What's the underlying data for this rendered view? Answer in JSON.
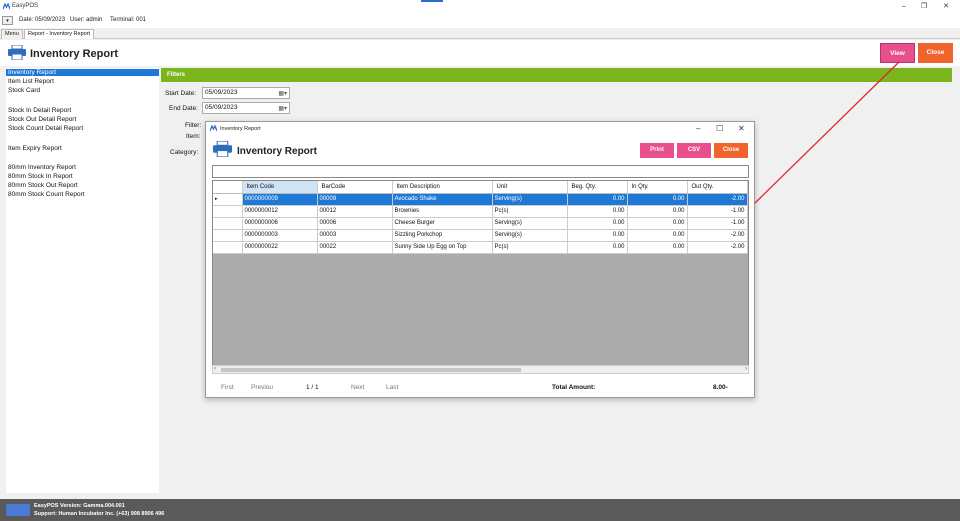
{
  "app": {
    "title": "EasyPOS"
  },
  "info": {
    "date": "Date: 05/09/2023",
    "user": "User: admin",
    "terminal": "Terminal: 001"
  },
  "tabs": [
    "Menu",
    "Report - Inventory Report"
  ],
  "header": {
    "title": "Inventory Report",
    "view_label": "View",
    "close_label": "Close"
  },
  "sidebar": {
    "items": [
      "Inventory Report",
      "Item List Report",
      "Stock Card",
      "Stock In Detail Report",
      "Stock Out Detail Report",
      "Stock Count Detail Report",
      "Item Expiry Report",
      "80mm Inventory Report",
      "80mm Stock In Report",
      "80mm Stock Out Report",
      "80mm Stock Count Report"
    ]
  },
  "filters": {
    "title": "Filters",
    "start_label": "Start Date:",
    "start_value": "05/09/2023",
    "end_label": "End Date:",
    "end_value": "05/09/2023",
    "filter_label": "Filter:",
    "item_label": "Item:",
    "category_label": "Category:"
  },
  "modal": {
    "window_title": "Inventory Report",
    "heading": "Inventory Report",
    "print_label": "Print",
    "csv_label": "CSV",
    "close_label": "Close",
    "columns": [
      "Item Code",
      "BarCode",
      "Item Description",
      "Unit",
      "Beg. Qty.",
      "In Qty.",
      "Out Qty."
    ],
    "rows": [
      [
        "0000000009",
        "00009",
        "Avocado Shake",
        "Serving(s)",
        "0.00",
        "0.00",
        "-2.00"
      ],
      [
        "0000000012",
        "00012",
        "Brownies",
        "Pc(s)",
        "0.00",
        "0.00",
        "-1.00"
      ],
      [
        "0000000006",
        "00006",
        "Cheese Burger",
        "Serving(s)",
        "0.00",
        "0.00",
        "-1.00"
      ],
      [
        "0000000003",
        "00003",
        "Sizzling Porkchop",
        "Serving(s)",
        "0.00",
        "0.00",
        "-2.00"
      ],
      [
        "0000000022",
        "00022",
        "Sunny Side Up Egg on Top",
        "Pc(s)",
        "0.00",
        "0.00",
        "-2.00"
      ]
    ],
    "pager": {
      "first": "First",
      "previous": "Previou",
      "page": "1 / 1",
      "next": "Next",
      "last": "Last"
    },
    "total_label": "Total Amount:",
    "total_value": "8.00-"
  },
  "status": {
    "version": "EasyPOS Version: Gamma.004.001",
    "support": "Support: Human Incubator Inc. (+63) 908 8906 496"
  },
  "colors": {
    "accent_green": "#7ab51d",
    "selection_blue": "#1e78d6",
    "pink": "#ea4f8d",
    "orange": "#f0642c"
  }
}
